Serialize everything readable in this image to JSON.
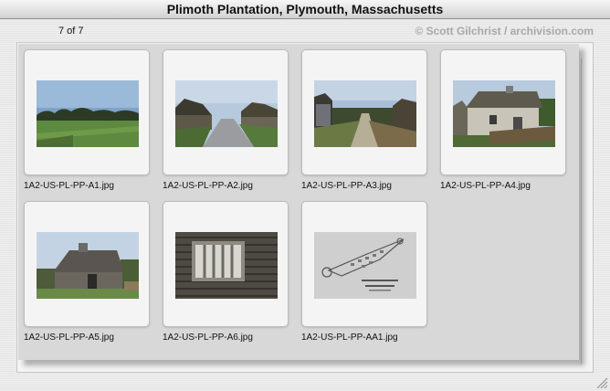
{
  "window": {
    "title": "Plimoth Plantation, Plymouth, Massachusetts"
  },
  "header": {
    "counter": "7 of 7",
    "credit": "© Scott Gilchrist / archivision.com"
  },
  "thumbnails": [
    {
      "filename": "1A2-US-PL-PP-A1.jpg",
      "icon": "field-landscape-photo"
    },
    {
      "filename": "1A2-US-PL-PP-A2.jpg",
      "icon": "village-street-photo"
    },
    {
      "filename": "1A2-US-PL-PP-A3.jpg",
      "icon": "village-path-photo"
    },
    {
      "filename": "1A2-US-PL-PP-A4.jpg",
      "icon": "thatched-house-photo"
    },
    {
      "filename": "1A2-US-PL-PP-A5.jpg",
      "icon": "wooden-house-photo"
    },
    {
      "filename": "1A2-US-PL-PP-A6.jpg",
      "icon": "window-clapboard-photo"
    },
    {
      "filename": "1A2-US-PL-PP-AA1.jpg",
      "icon": "plantation-map-sign-photo"
    }
  ]
}
